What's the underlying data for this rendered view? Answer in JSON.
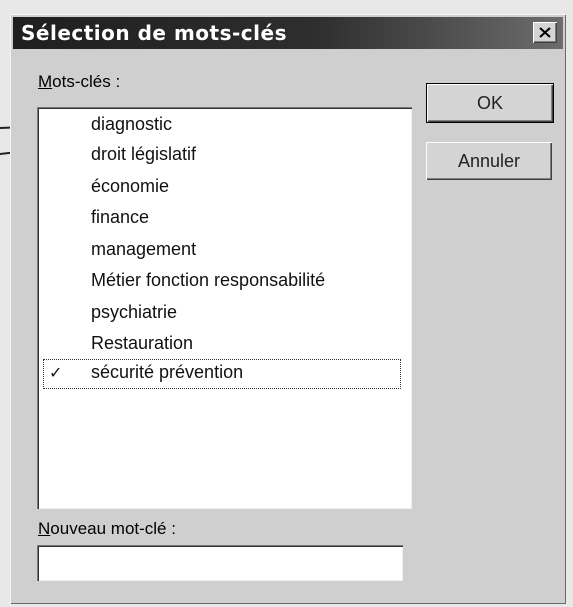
{
  "dialog": {
    "title": "Sélection de mots-clés",
    "close_icon": "close-icon",
    "keywords_label_accel": "M",
    "keywords_label_rest": "ots-clés :",
    "ok_label": "OK",
    "cancel_label": "Annuler",
    "new_keyword_label_accel": "N",
    "new_keyword_label_rest": "ouveau mot-clé :",
    "new_keyword_value": ""
  },
  "keywords": [
    {
      "label": "diagnostic",
      "checked": false
    },
    {
      "label": "droit législatif",
      "checked": false
    },
    {
      "label": "économie",
      "checked": false
    },
    {
      "label": "finance",
      "checked": false
    },
    {
      "label": "management",
      "checked": false
    },
    {
      "label": "Métier fonction responsabilité",
      "checked": false
    },
    {
      "label": "psychiatrie",
      "checked": false
    },
    {
      "label": "Restauration",
      "checked": false
    },
    {
      "label": "sécurité prévention",
      "checked": true,
      "check_mark": "✓"
    }
  ],
  "colors": {
    "titlebar": "#1f1f1f",
    "dialog_bg": "#cfcfcf",
    "list_bg": "#ffffff"
  }
}
